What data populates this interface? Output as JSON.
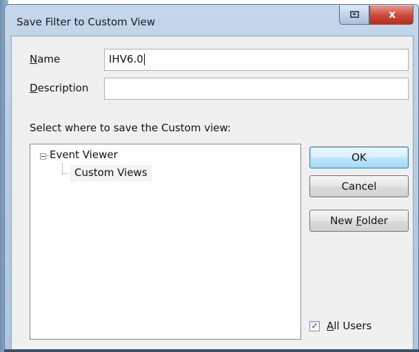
{
  "window": {
    "title": "Save Filter to Custom View",
    "restore_icon": "restore-icon",
    "close_icon": "close-icon",
    "close_glyph": "x"
  },
  "form": {
    "name_label_mnemonic": "N",
    "name_label_rest": "ame",
    "name_value": "IHV6.0",
    "description_label_mnemonic": "D",
    "description_label_rest": "escription",
    "description_value": "",
    "location_prompt": "Select where to save the Custom view:"
  },
  "tree": {
    "root_label": "Event Viewer",
    "child_label": "Custom Views"
  },
  "buttons": {
    "ok_label": "OK",
    "cancel_label": "Cancel",
    "new_folder_prefix": "New ",
    "new_folder_mnemonic": "F",
    "new_folder_rest": "older"
  },
  "all_users": {
    "checked": true,
    "check_glyph": "✓",
    "label_mnemonic": "A",
    "label_rest": "ll Users"
  },
  "colors": {
    "close_button": "#c9473a",
    "default_button_border": "#3c7fb1",
    "dialog_background": "#f0f0f0"
  }
}
